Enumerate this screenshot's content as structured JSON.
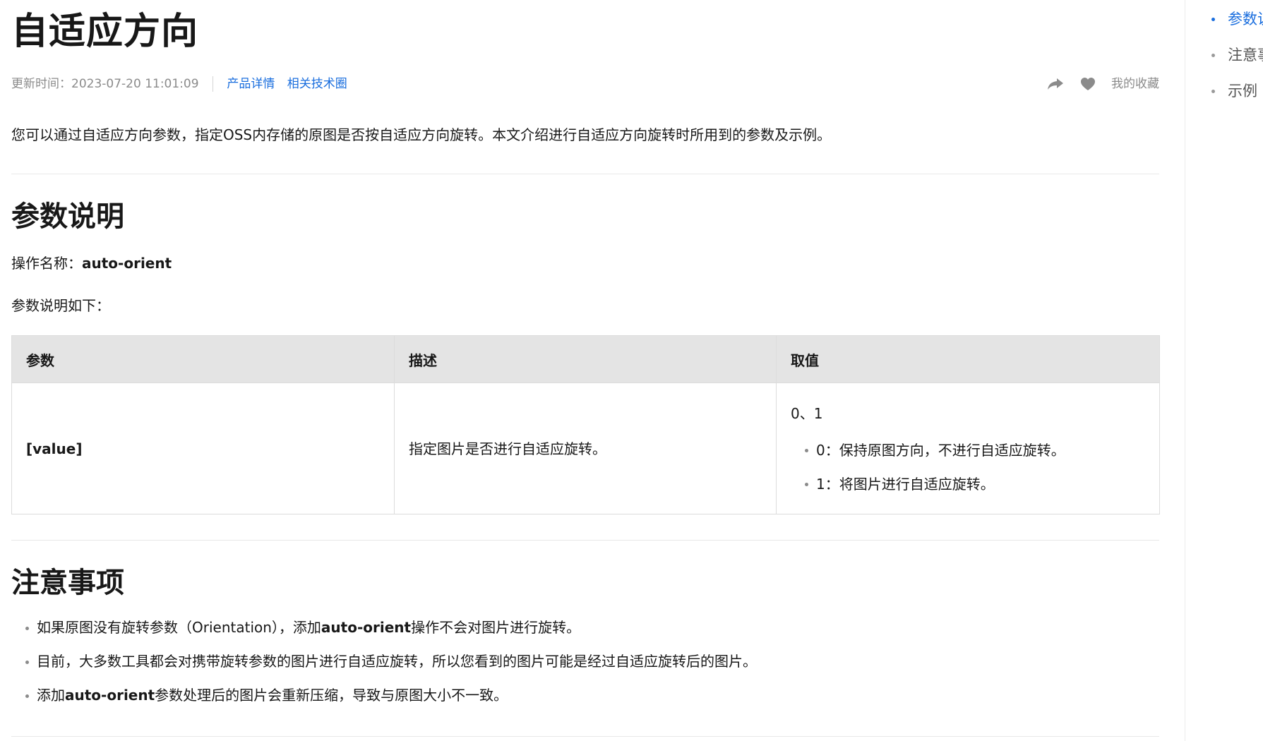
{
  "page": {
    "title": "自适应方向",
    "meta": {
      "updated": "更新时间：2023-07-20 11:01:09",
      "links": [
        "产品详情",
        "相关技术圈"
      ],
      "favorite_label": "我的收藏",
      "share_icon": "share-icon",
      "heart_icon": "heart-icon"
    },
    "intro": "您可以通过自适应方向参数，指定OSS内存储的原图是否按自适应方向旋转。本文介绍进行自适应方向旋转时所用到的参数及示例。"
  },
  "params_section": {
    "heading": "参数说明",
    "op_label": "操作名称：",
    "op_name": "auto-orient",
    "table_intro": "参数说明如下：",
    "table": {
      "headers": [
        "参数",
        "描述",
        "取值"
      ],
      "row": {
        "param": "[value]",
        "desc": "指定图片是否进行自适应旋转。",
        "value_head": "0、1",
        "value_items": [
          "0：保持原图方向，不进行自适应旋转。",
          "1：将图片进行自适应旋转。"
        ]
      }
    }
  },
  "notes_section": {
    "heading": "注意事项",
    "items": [
      {
        "pre": "如果原图没有旋转参数（Orientation），添加",
        "bold": "auto-orient",
        "post": "操作不会对图片进行旋转。"
      },
      {
        "pre": "目前，大多数工具都会对携带旋转参数的图片进行自适应旋转，所以您看到的图片可能是经过自适应旋转后的图片。",
        "bold": "",
        "post": ""
      },
      {
        "pre": "添加",
        "bold": "auto-orient",
        "post": "参数处理后的图片会重新压缩，导致与原图大小不一致。"
      }
    ]
  },
  "toc": {
    "items": [
      "参数说明",
      "注意事项",
      "示例"
    ],
    "active_color": "#1a6ede"
  },
  "colors": {
    "link": "#1a6ede",
    "muted": "#8b8b8b",
    "table_header_bg": "#e4e4e4"
  }
}
